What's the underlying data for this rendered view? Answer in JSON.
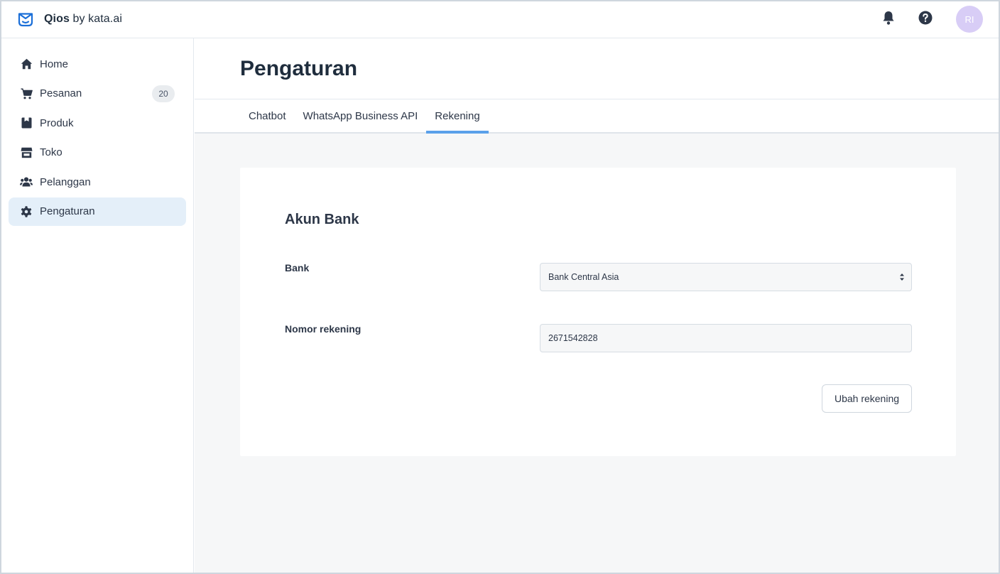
{
  "app": {
    "brand_name": "Qios",
    "brand_suffix": " by kata.ai",
    "avatar_initials": "RI"
  },
  "topbar": {
    "icons": [
      "bell-icon",
      "help-icon"
    ]
  },
  "sidebar": {
    "items": [
      {
        "label": "Home",
        "icon": "home-icon"
      },
      {
        "label": "Pesanan",
        "icon": "cart-icon",
        "badge": "20"
      },
      {
        "label": "Produk",
        "icon": "product-icon"
      },
      {
        "label": "Toko",
        "icon": "store-icon"
      },
      {
        "label": "Pelanggan",
        "icon": "users-icon"
      },
      {
        "label": "Pengaturan",
        "icon": "gear-icon",
        "active": true
      }
    ]
  },
  "page": {
    "title": "Pengaturan"
  },
  "tabs": [
    {
      "label": "Chatbot"
    },
    {
      "label": "WhatsApp Business API"
    },
    {
      "label": "Rekening",
      "active": true
    }
  ],
  "card": {
    "title": "Akun Bank",
    "bank_label": "Bank",
    "bank_value": "Bank Central Asia",
    "account_label": "Nomor rekening",
    "account_value": "2671542828",
    "button_label": "Ubah rekening"
  },
  "colors": {
    "accent": "#5aa0ea",
    "active_nav_bg": "#e4eff9",
    "avatar_bg": "#d8cdf6",
    "brand_logo": "#1b6fd8"
  }
}
